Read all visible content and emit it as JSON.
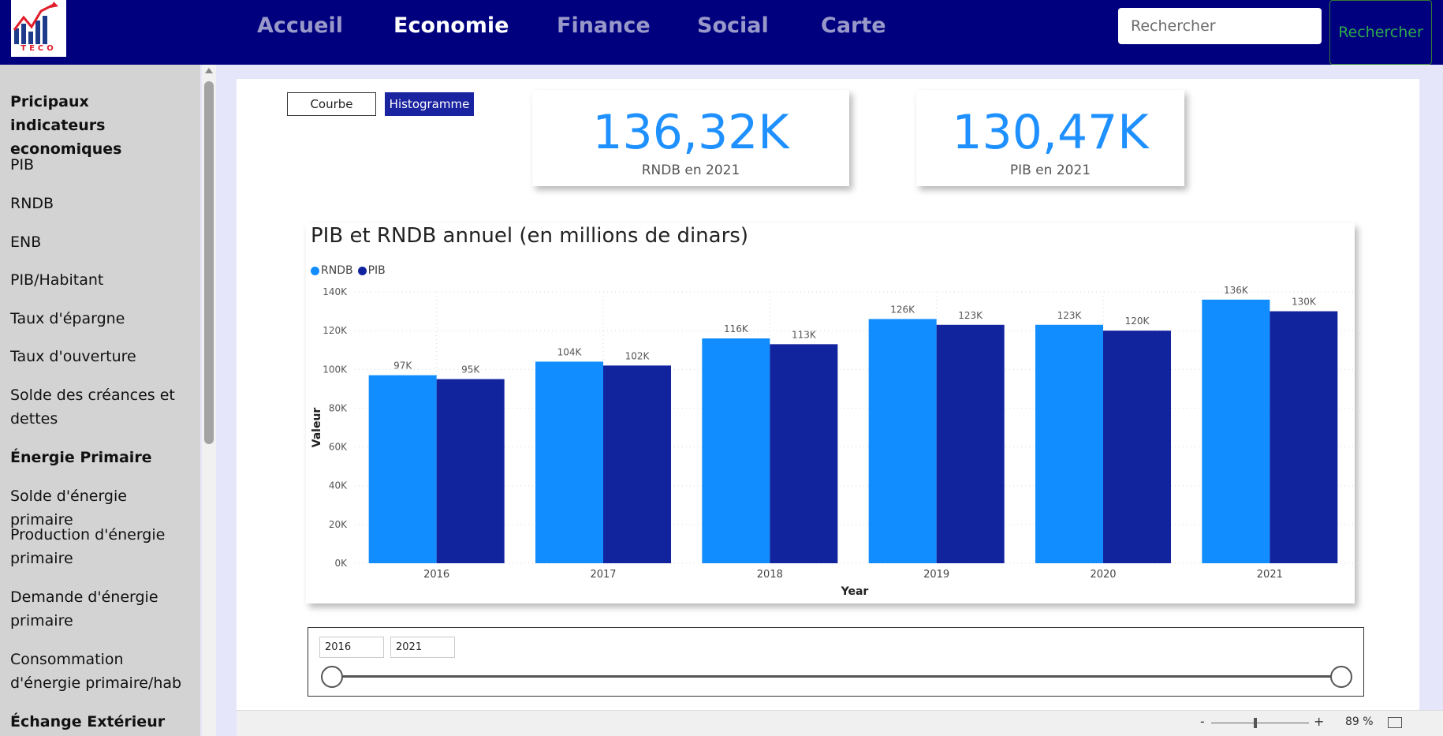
{
  "navbar": {
    "items": [
      {
        "label": "Accueil",
        "active": false
      },
      {
        "label": "Economie",
        "active": true
      },
      {
        "label": "Finance",
        "active": false
      },
      {
        "label": "Social",
        "active": false
      },
      {
        "label": "Carte",
        "active": false
      }
    ],
    "search_placeholder": "Rechercher",
    "search_button": "Rechercher"
  },
  "sidebar": {
    "items": [
      {
        "label": "Pricipaux indicateurs economiques",
        "heading": true
      },
      {
        "label": "PIB",
        "heading": false
      },
      {
        "label": "RNDB",
        "heading": false
      },
      {
        "label": "ENB",
        "heading": false
      },
      {
        "label": "PIB/Habitant",
        "heading": false
      },
      {
        "label": "Taux d'épargne",
        "heading": false
      },
      {
        "label": "Taux d'ouverture",
        "heading": false
      },
      {
        "label": "Solde des créances et dettes",
        "heading": false
      },
      {
        "label": "Énergie Primaire",
        "heading": true
      },
      {
        "label": "Solde d'énergie primaire",
        "heading": false
      },
      {
        "label": "Production d'énergie primaire",
        "heading": false
      },
      {
        "label": "Demande d'énergie primaire",
        "heading": false
      },
      {
        "label": "Consommation d'énergie primaire/hab",
        "heading": false
      },
      {
        "label": "Échange Extérieur",
        "heading": true
      }
    ]
  },
  "toggles": {
    "courbe": "Courbe",
    "histogramme": "Histogramme"
  },
  "kpis": [
    {
      "value": "136,32K",
      "label": "RNDB  en 2021"
    },
    {
      "value": "130,47K",
      "label": "PIB  en 2021"
    }
  ],
  "slicer": {
    "start": "2016",
    "end": "2021"
  },
  "statusbar": {
    "zoom_minus": "-",
    "zoom_plus": "+",
    "zoom": "89 %"
  },
  "colors": {
    "rndb": "#118dff",
    "pib": "#12239e",
    "accent": "#00007f"
  },
  "chart_data": {
    "type": "bar",
    "title": "PIB et RNDB annuel (en millions de dinars)",
    "xlabel": "Year",
    "ylabel": "Valeur",
    "categories": [
      "2016",
      "2017",
      "2018",
      "2019",
      "2020",
      "2021"
    ],
    "series": [
      {
        "name": "RNDB",
        "values": [
          97,
          104,
          116,
          126,
          123,
          136
        ],
        "labels": [
          "97K",
          "104K",
          "116K",
          "126K",
          "123K",
          "136K"
        ]
      },
      {
        "name": "PIB",
        "values": [
          95,
          102,
          113,
          123,
          120,
          130
        ],
        "labels": [
          "95K",
          "102K",
          "113K",
          "123K",
          "120K",
          "130K"
        ]
      }
    ],
    "ylim": [
      0,
      140
    ],
    "yticks": [
      "0K",
      "20K",
      "40K",
      "60K",
      "80K",
      "100K",
      "120K",
      "140K"
    ],
    "grid": true,
    "legend": "top-left"
  }
}
